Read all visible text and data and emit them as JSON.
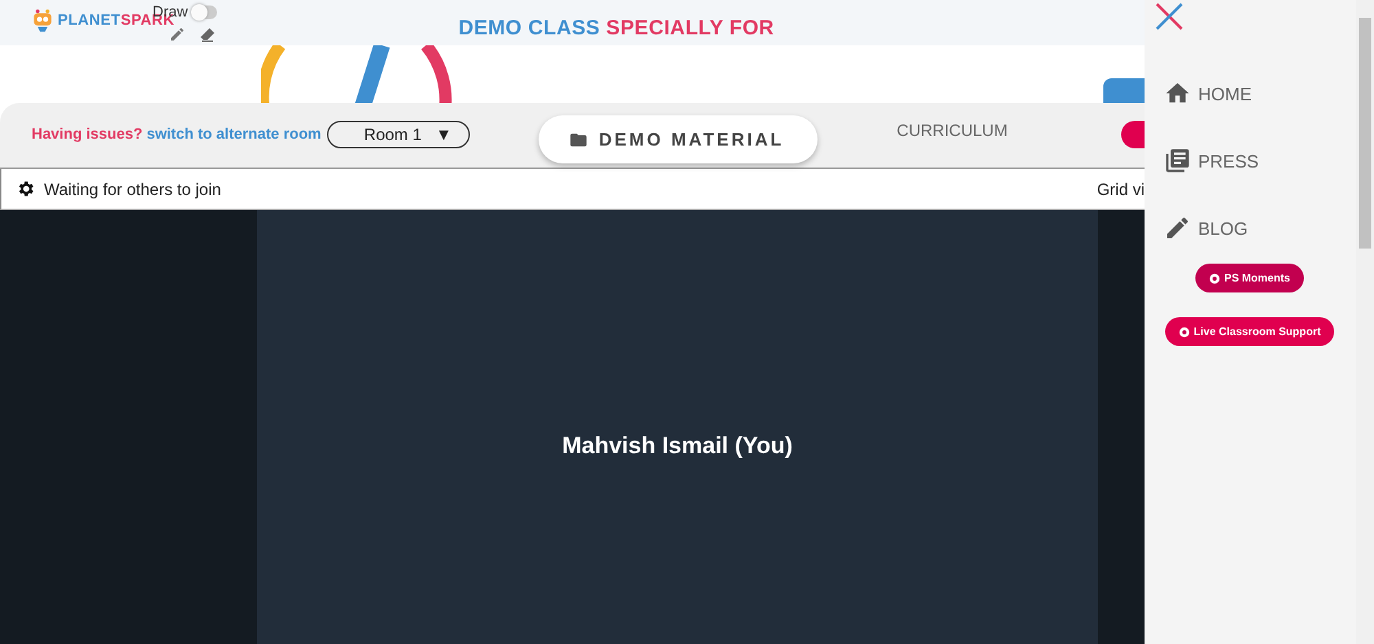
{
  "header": {
    "logo": {
      "part_1": "PLANET",
      "part_2": "SPARK"
    },
    "draw_toggle": {
      "label": "Draw",
      "on": false
    },
    "title": {
      "part_1": "DEMO CLASS",
      "part_2": "SPECIALLY FOR"
    }
  },
  "toolbar": {
    "issue_text": "Having issues?",
    "switch_link": "switch to alternate room",
    "room_select": {
      "value": "Room 1",
      "caret": "▼"
    },
    "tabs": [
      {
        "label": "DEMO MATERIAL",
        "selected": true
      },
      {
        "label": "CURRICULUM",
        "selected": false
      }
    ]
  },
  "status_bar": {
    "text": "Waiting for others to join",
    "view_link": "Grid vi"
  },
  "video": {
    "participant": "Mahvish Ismail (You)"
  },
  "sidebar": {
    "items": [
      {
        "label": "HOME"
      },
      {
        "label": "PRESS"
      },
      {
        "label": "BLOG"
      }
    ],
    "buttons": [
      {
        "label": "PS Moments",
        "color": "#c2004f"
      },
      {
        "label": "Live Classroom Support",
        "color": "#e0004f"
      }
    ]
  }
}
